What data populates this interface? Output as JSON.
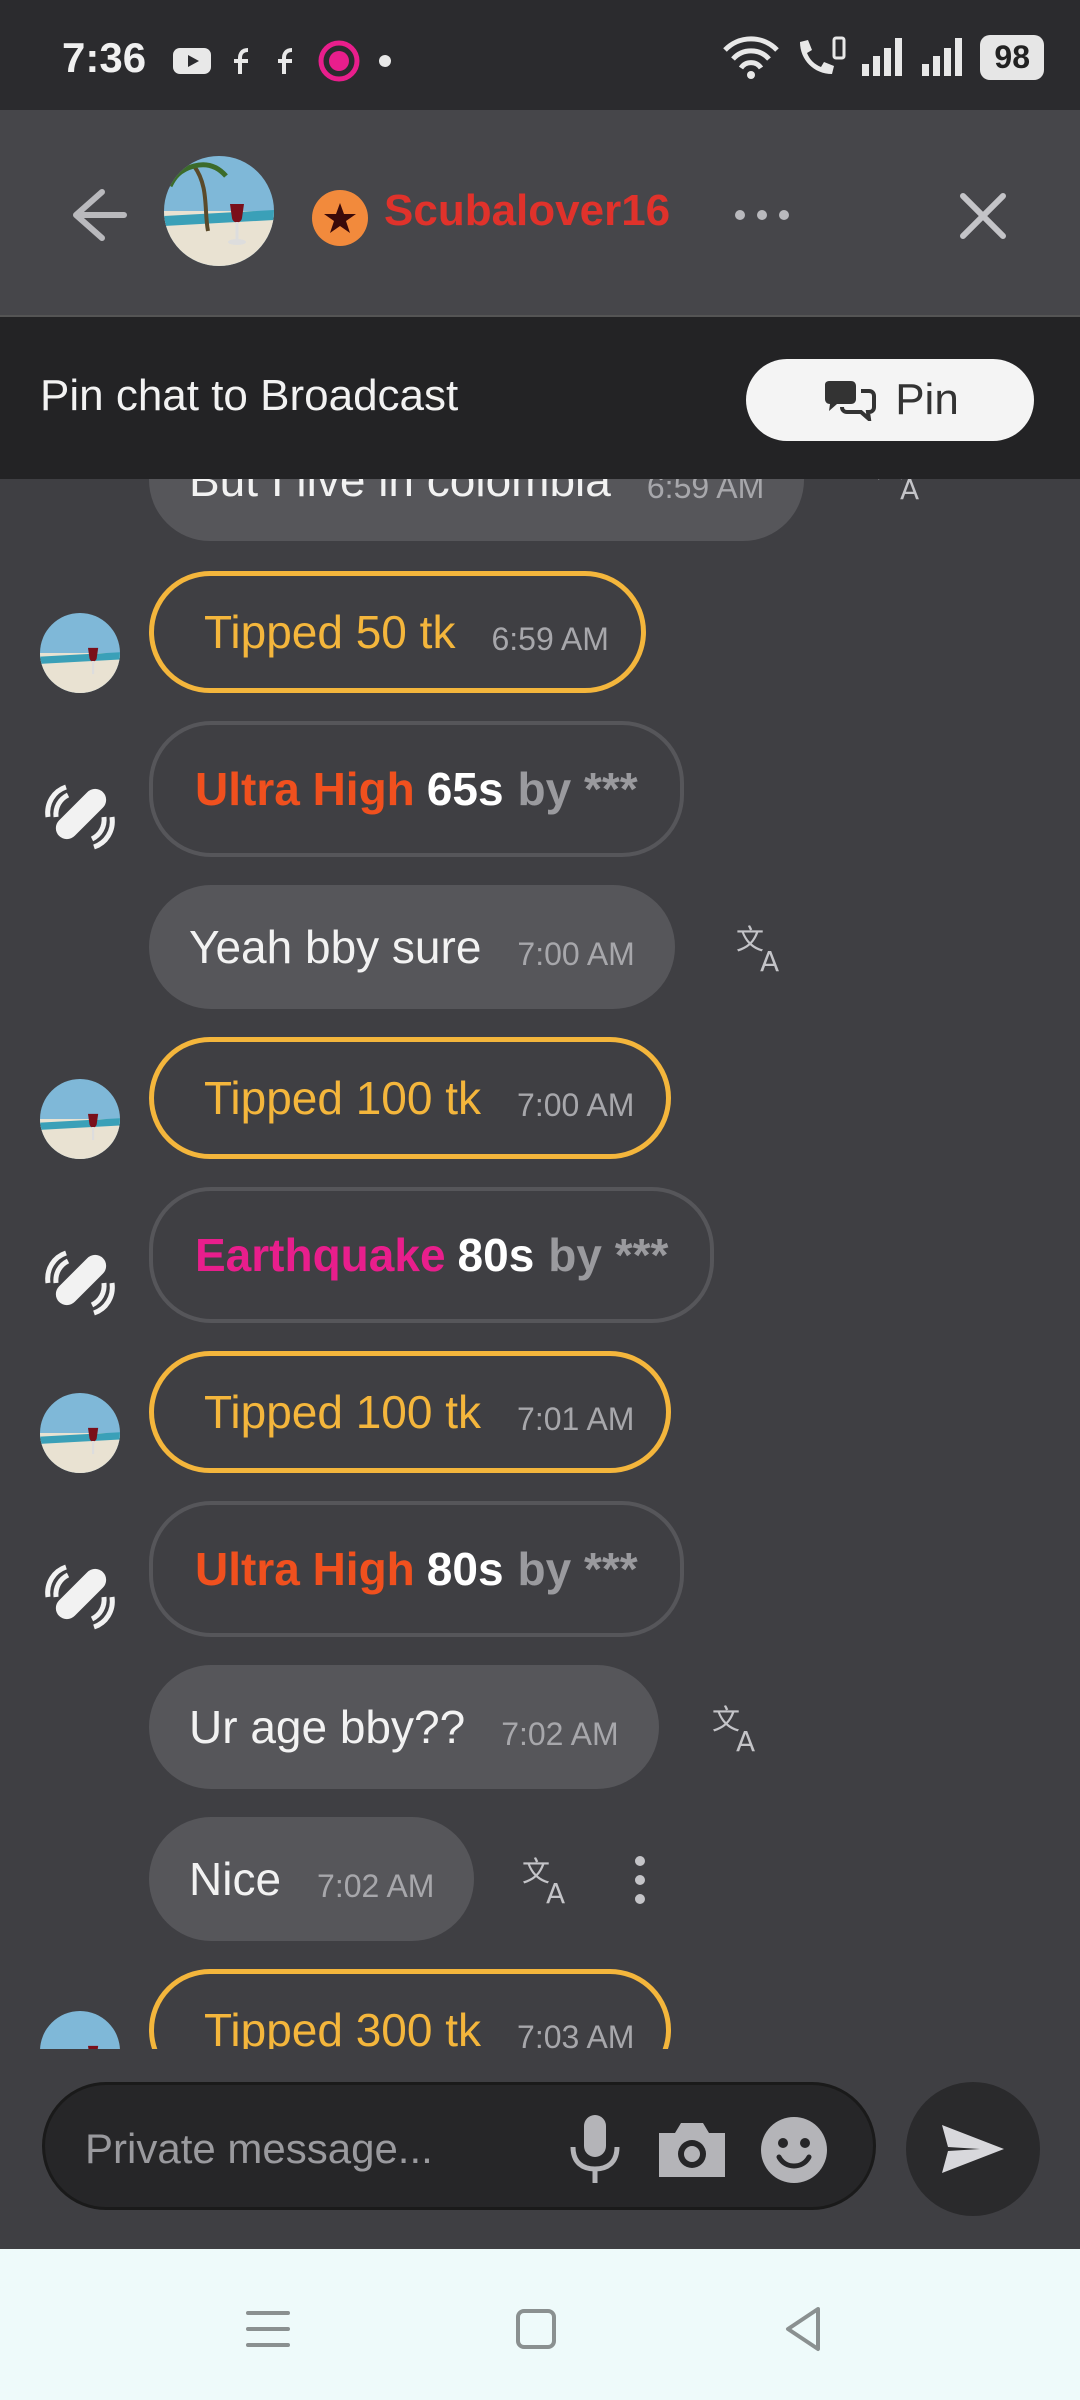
{
  "status_bar": {
    "time": "7:36",
    "battery": "98"
  },
  "header": {
    "username": "Scubalover16"
  },
  "pin_bar": {
    "text": "Pin chat to Broadcast",
    "button_label": "Pin"
  },
  "messages": [
    {
      "kind": "msg",
      "text": "But I live in colombia",
      "time": "6:59 AM"
    },
    {
      "kind": "tip",
      "text": "Tipped 50 tk",
      "time": "6:59 AM"
    },
    {
      "kind": "vib",
      "level": "Ultra High",
      "duration": "65s",
      "by": "by ***"
    },
    {
      "kind": "msg",
      "text": "Yeah bby sure",
      "time": "7:00 AM"
    },
    {
      "kind": "tip",
      "text": "Tipped 100 tk",
      "time": "7:00 AM"
    },
    {
      "kind": "vib",
      "level": "Earthquake",
      "duration": "80s",
      "by": "by ***"
    },
    {
      "kind": "tip",
      "text": "Tipped 100 tk",
      "time": "7:01 AM"
    },
    {
      "kind": "vib",
      "level": "Ultra High",
      "duration": "80s",
      "by": "by ***"
    },
    {
      "kind": "msg",
      "text": "Ur age bby??",
      "time": "7:02 AM"
    },
    {
      "kind": "msg",
      "text": "Nice",
      "time": "7:02 AM"
    },
    {
      "kind": "tip",
      "text": "Tipped 300 tk",
      "time": "7:03 AM"
    }
  ],
  "composer": {
    "placeholder": "Private message..."
  },
  "colors": {
    "accent_tip": "#f4b63c",
    "username": "#e0322b",
    "ultra_high": "#f0501e",
    "earthquake": "#e81e8c"
  }
}
